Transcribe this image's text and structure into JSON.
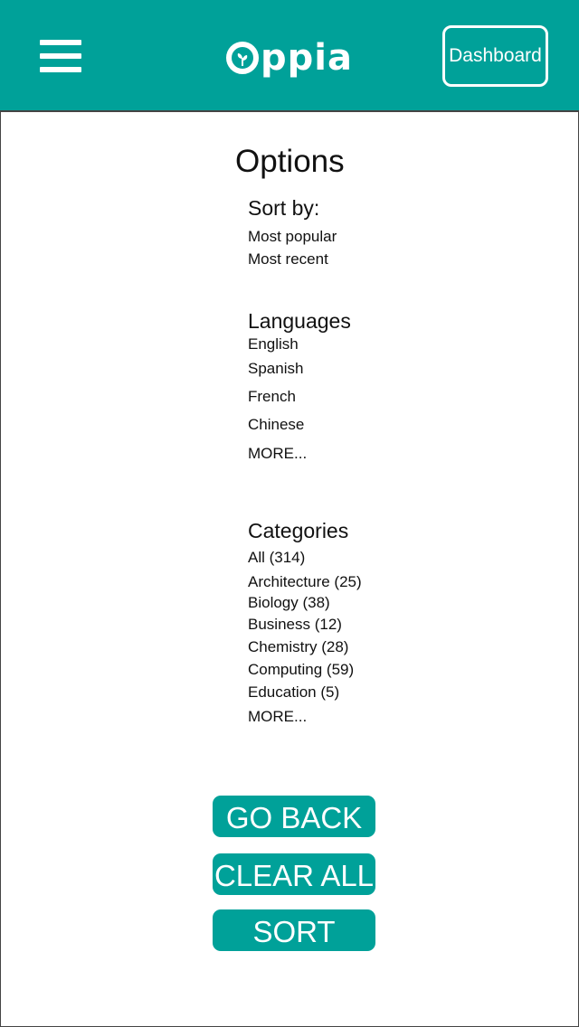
{
  "header": {
    "brand": "ppia",
    "dashboard_label": "Dashboard",
    "color": "#00a199"
  },
  "page_title": "Options",
  "sort": {
    "heading": "Sort by:",
    "options": [
      "Most popular",
      "Most recent"
    ]
  },
  "languages": {
    "heading": "Languages",
    "items": [
      "English",
      "Spanish",
      "French",
      "Chinese"
    ],
    "more": "MORE..."
  },
  "categories": {
    "heading": "Categories",
    "items": [
      "All (314)",
      "Architecture (25)",
      "Biology (38)",
      "Business (12)",
      "Chemistry (28)",
      "Computing (59)",
      "Education (5)"
    ],
    "more": "MORE..."
  },
  "actions": {
    "go_back": "GO BACK",
    "clear_all": "CLEAR ALL",
    "sort": "SORT"
  },
  "icons": [
    "menu-icon",
    "oppia-logo-icon"
  ]
}
